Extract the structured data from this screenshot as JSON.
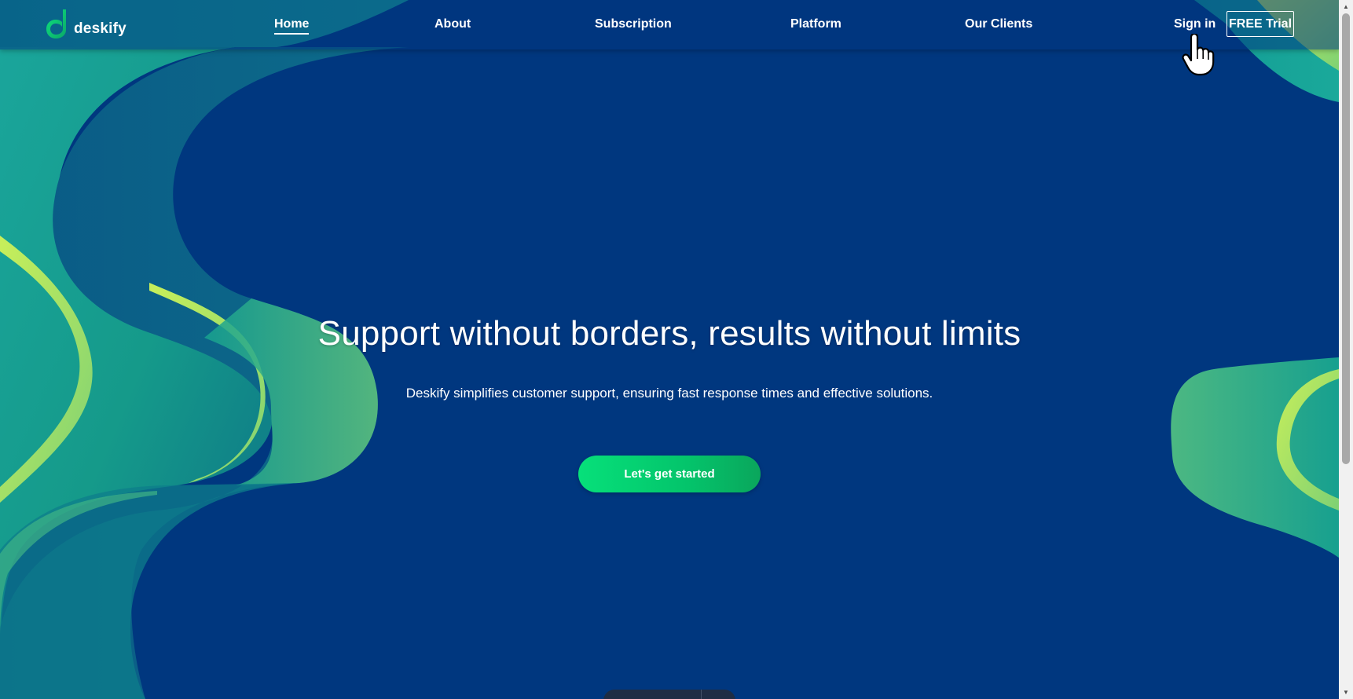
{
  "brand": {
    "name": "deskify",
    "logo_icon": "deskify-logo-icon"
  },
  "nav": {
    "items": [
      {
        "label": "Home",
        "active": true
      },
      {
        "label": "About",
        "active": false
      },
      {
        "label": "Subscription",
        "active": false
      },
      {
        "label": "Platform",
        "active": false
      },
      {
        "label": "Our Clients",
        "active": false
      }
    ],
    "sign_in": "Sign in",
    "trial": "FREE Trial"
  },
  "hero": {
    "title": "Support without borders, results without limits",
    "subtitle": "Deskify simplifies customer support, ensuring fast response times and effective solutions.",
    "cta": "Let's get started"
  },
  "colors": {
    "background": "#00377f",
    "accent_green": "#06e07a",
    "wave_teal": "#0f8f8a",
    "wave_lime": "#c6ef5a"
  },
  "icons": {
    "cursor": "hand-pointer-icon",
    "scroll_up": "scroll-up-arrow-icon",
    "scroll_down": "scroll-down-arrow-icon"
  }
}
